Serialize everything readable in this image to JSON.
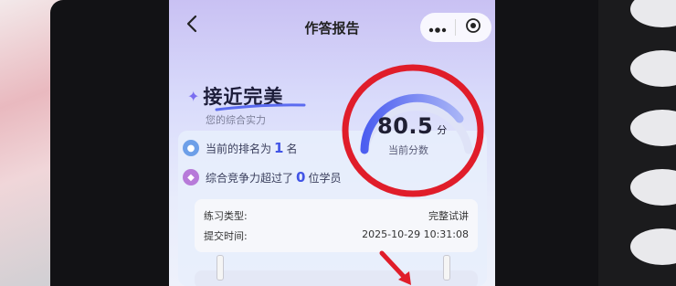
{
  "navbar": {
    "back_icon": "chevron-left-icon",
    "title": "作答报告",
    "more_icon": "more-dots-icon",
    "close_icon": "target-close-icon"
  },
  "summary": {
    "headline": "接近完美",
    "subtitle": "您的综合实力",
    "rank_prefix": "当前的排名为",
    "rank_value": "1",
    "rank_suffix": "名",
    "beat_prefix": "综合竞争力超过了",
    "beat_value": "0",
    "beat_suffix": "位学员"
  },
  "score": {
    "value": "80.5",
    "unit": "分",
    "label": "当前分数"
  },
  "details": {
    "type_label": "练习类型:",
    "type_value": "完整试讲",
    "time_label": "提交时间:",
    "time_value": "2025-10-29 10:31:08"
  },
  "colors": {
    "accent": "#4255e6",
    "annotation_red": "#e01d2a"
  }
}
